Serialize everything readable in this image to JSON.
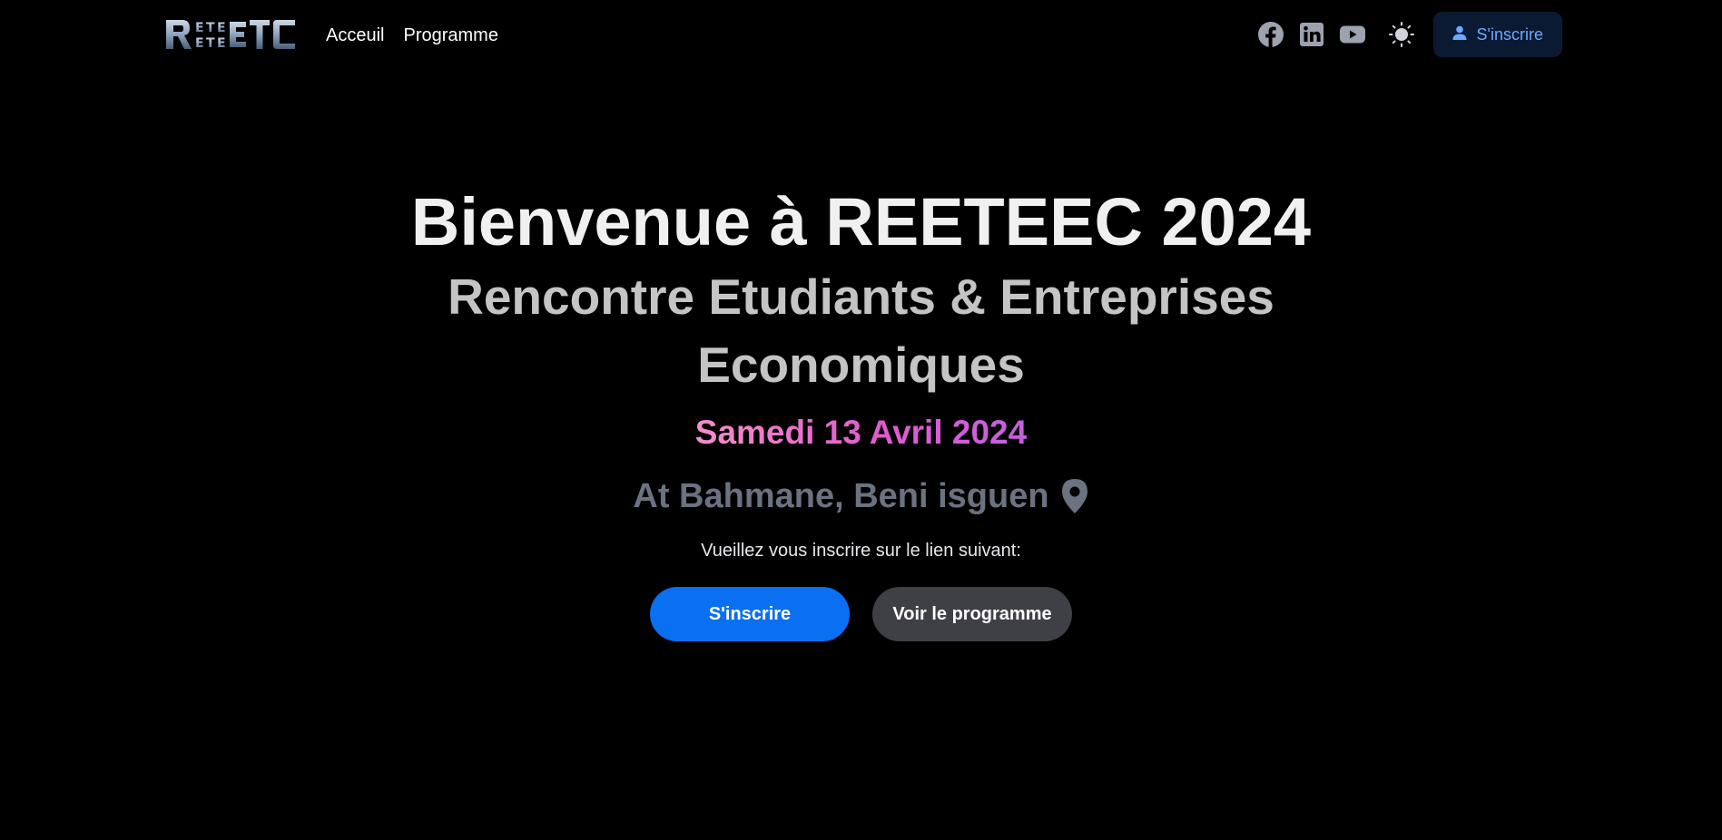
{
  "nav": {
    "logo_text": "RETEC",
    "links": [
      {
        "label": "Acceuil"
      },
      {
        "label": "Programme"
      }
    ],
    "social_icons": [
      "facebook-icon",
      "linkedin-icon",
      "youtube-icon"
    ],
    "theme_icon": "sun-icon",
    "signup_label": "S'inscrire"
  },
  "hero": {
    "title": "Bienvenue à REETEEC 2024",
    "subtitle": "Rencontre Etudiants & Entreprises Economiques",
    "date": "Samedi 13 Avril 2024",
    "location": "At Bahmane, Beni isguen",
    "prompt": "Vueillez vous inscrire sur le lien suivant:",
    "primary_button": "S'inscrire",
    "secondary_button": "Voir le programme"
  },
  "colors": {
    "background": "#000000",
    "accent_blue": "#0a6ff0",
    "secondary_button": "#3f3f46",
    "date_gradient_start": "#f48fcb",
    "date_gradient_end": "#c35fe0",
    "location_gray": "#6b7280",
    "nav_signup_bg": "#0b1a33",
    "nav_signup_text": "#6ea8fe"
  }
}
